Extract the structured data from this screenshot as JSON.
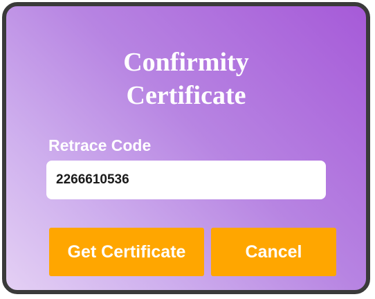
{
  "dialog": {
    "title_line1": "Confirmity",
    "title_line2": "Certificate",
    "field_label": "Retrace Code",
    "code_value": "2266610536",
    "get_certificate_label": "Get Certificate",
    "cancel_label": "Cancel"
  },
  "colors": {
    "gradient_start": "#a65ad8",
    "gradient_end": "#e4d0f4",
    "button": "#ffa600",
    "border": "#3a3a3a",
    "text": "#ffffff"
  }
}
